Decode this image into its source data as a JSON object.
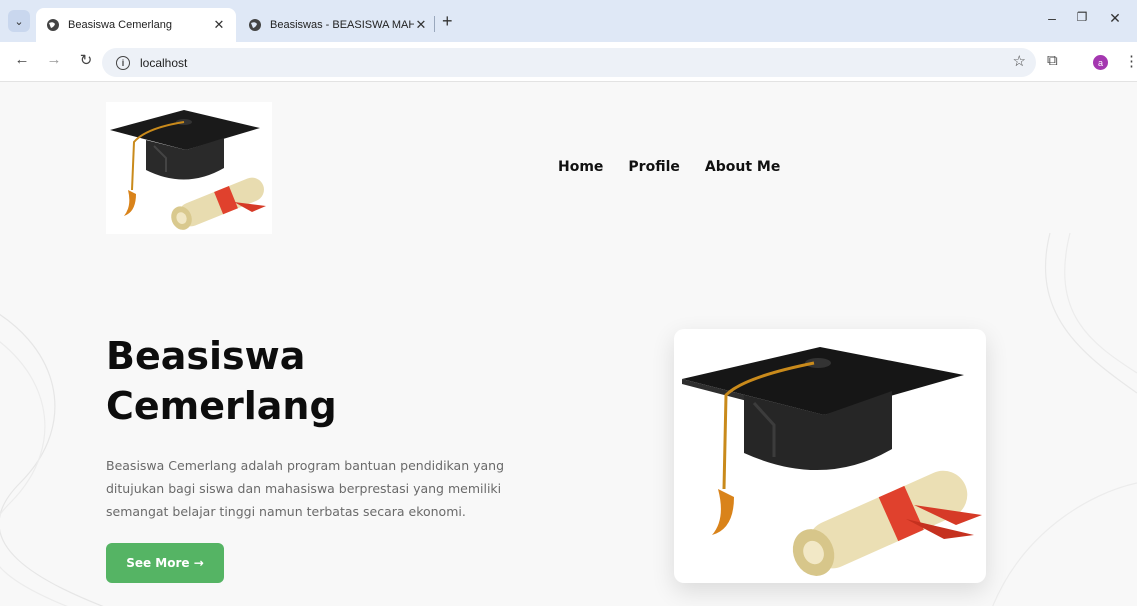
{
  "browser": {
    "tabs": [
      {
        "title": "Beasiswa Cemerlang",
        "active": true
      },
      {
        "title": "Beasiswas - BEASISWA MAHASI",
        "active": false
      }
    ],
    "address": "localhost",
    "avatar_letter": "a"
  },
  "nav": {
    "items": [
      "Home",
      "Profile",
      "About Me"
    ]
  },
  "hero": {
    "title_line1": "Beasiswa",
    "title_line2": "Cemerlang",
    "description": "Beasiswa Cemerlang adalah program bantuan pendidikan yang ditujukan bagi siswa dan mahasiswa berprestasi yang memiliki semangat belajar tinggi namun terbatas secara ekonomi.",
    "button_label": "See More →"
  },
  "colors": {
    "accent": "#55b464",
    "tabbar": "#dfe8f6"
  }
}
